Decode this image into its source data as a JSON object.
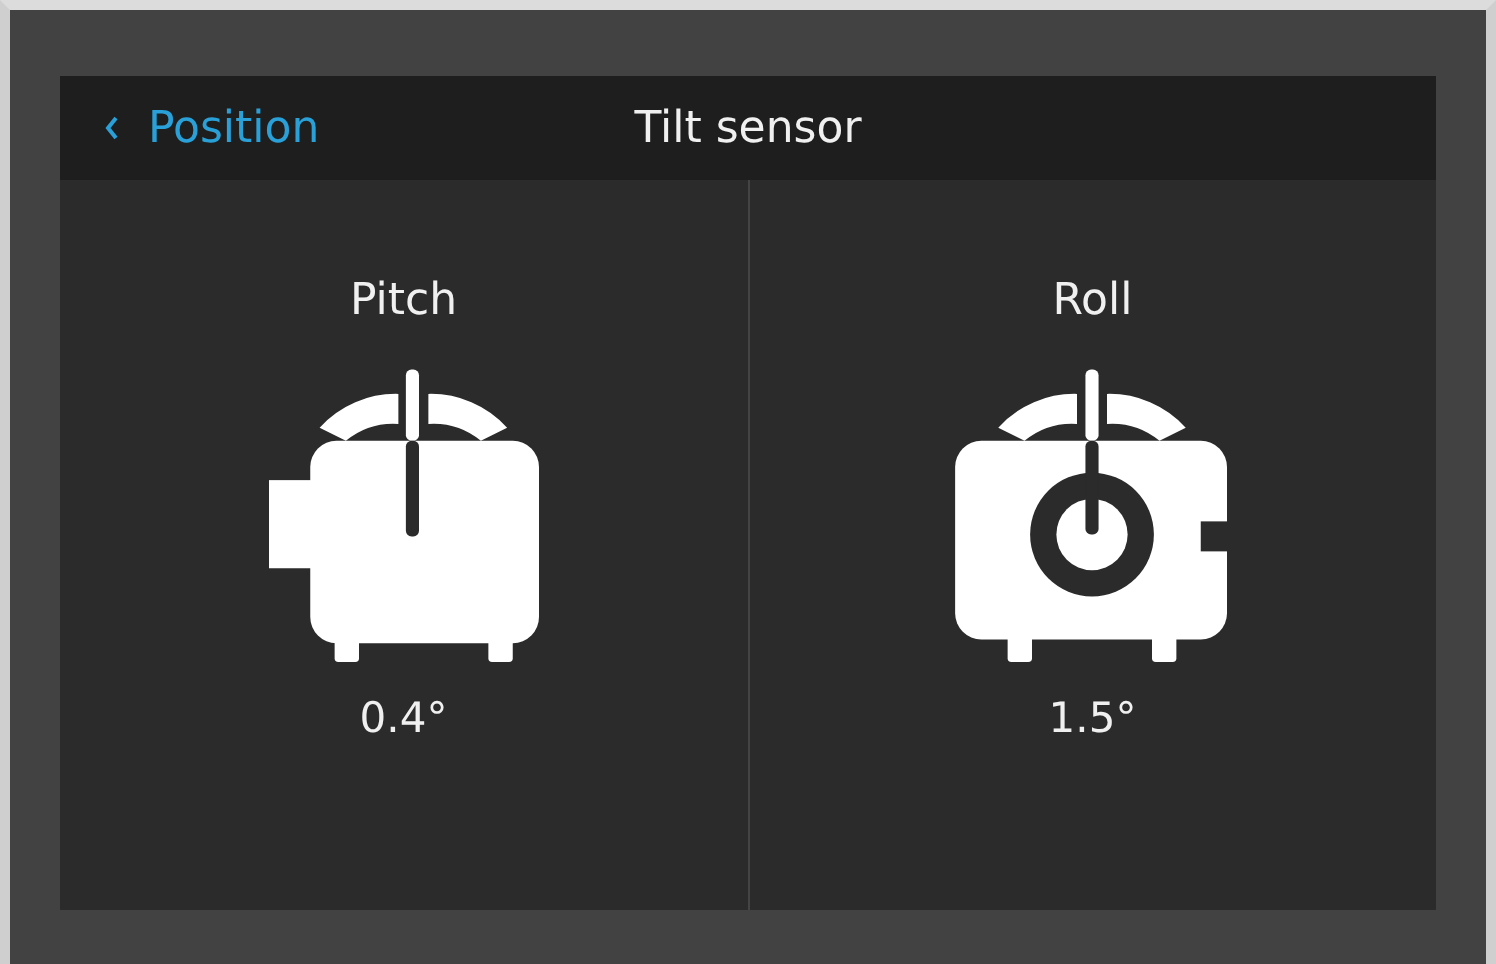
{
  "header": {
    "back_label": "Position",
    "title": "Tilt sensor"
  },
  "panels": [
    {
      "kind": "pitch",
      "label": "Pitch",
      "reading": "0.4°"
    },
    {
      "kind": "roll",
      "label": "Roll",
      "reading": "1.5°"
    }
  ]
}
